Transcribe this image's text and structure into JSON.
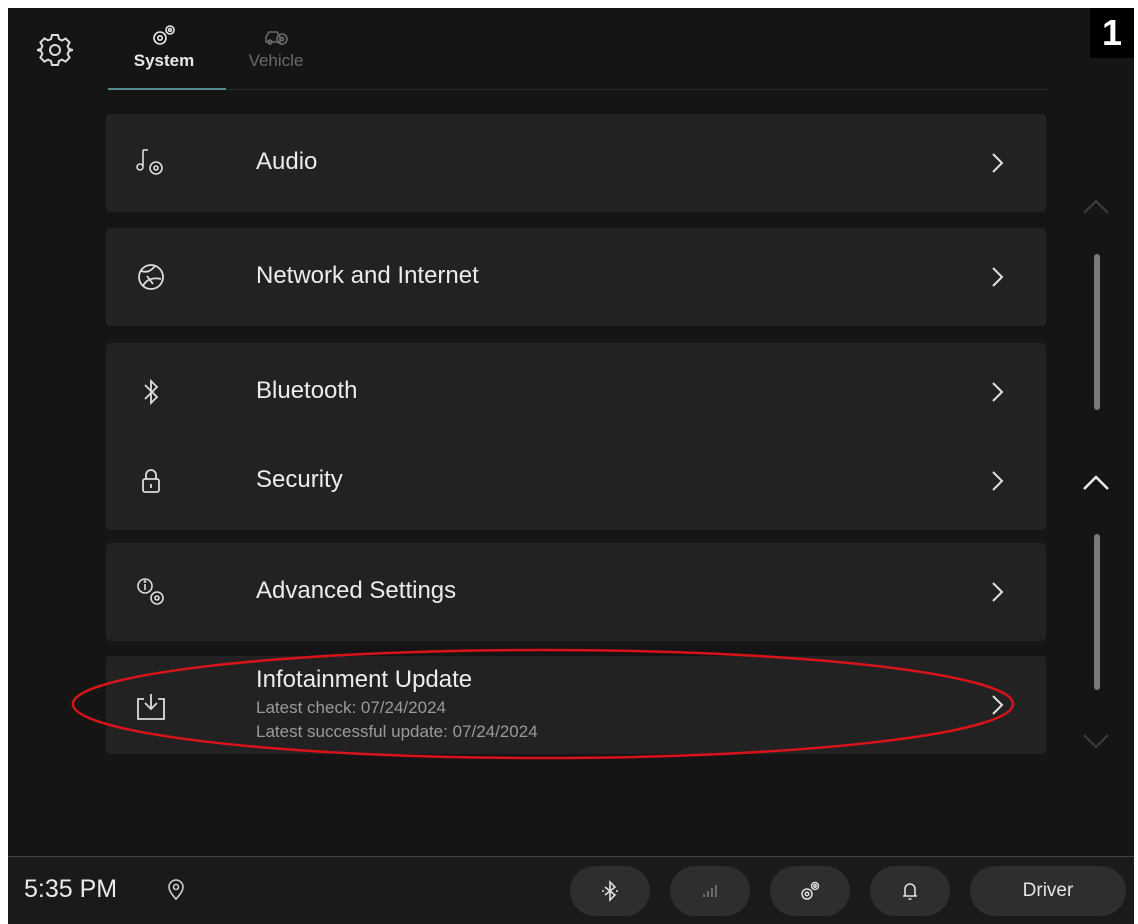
{
  "badge": "1",
  "header": {
    "settings_icon": "gear-icon",
    "tabs": [
      {
        "label": "System",
        "icon": "gears-icon",
        "active": true
      },
      {
        "label": "Vehicle",
        "icon": "car-gear-icon",
        "active": false
      }
    ]
  },
  "menu": {
    "items": [
      {
        "label": "Audio",
        "icon": "music-gear-icon"
      },
      {
        "label": "Network and Internet",
        "icon": "globe-icon"
      },
      {
        "label": "Bluetooth",
        "icon": "bluetooth-icon"
      },
      {
        "label": "Security",
        "icon": "lock-icon"
      },
      {
        "label": "Advanced Settings",
        "icon": "info-gear-icon"
      },
      {
        "label": "Infotainment Update",
        "icon": "download-tray-icon",
        "latest_check": "Latest check: 07/24/2024",
        "latest_success": "Latest successful update: 07/24/2024",
        "highlighted": true
      }
    ]
  },
  "bottom_bar": {
    "time": "5:35 PM",
    "location_icon": "location-pin-icon",
    "quick_buttons": [
      "bluetooth-icon",
      "signal-bars-icon",
      "gears-icon",
      "bell-icon"
    ],
    "profile_label": "Driver"
  },
  "colors": {
    "background": "#151515",
    "row": "#222222",
    "highlight": "#d8141a",
    "tab_underline": "#5a8a90"
  }
}
